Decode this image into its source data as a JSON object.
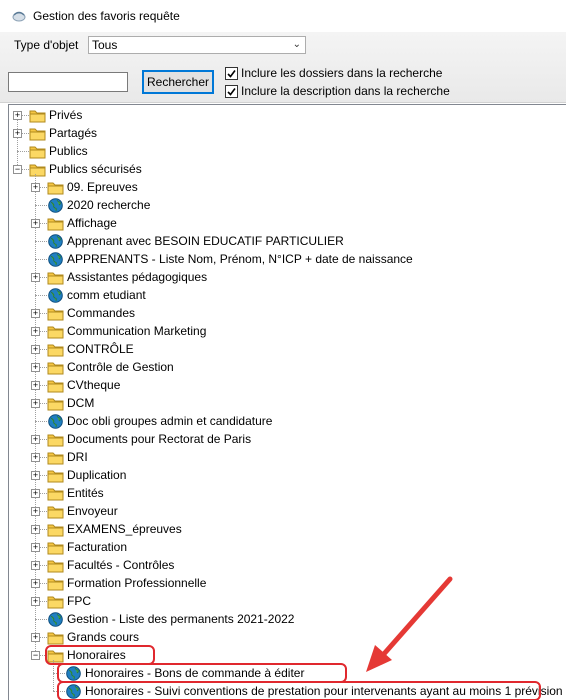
{
  "window": {
    "title": "Gestion des favoris requête",
    "icon": "app-icon"
  },
  "filters": {
    "type_label": "Type d'objet",
    "type_value": "Tous",
    "search_value": "",
    "search_button": "Rechercher",
    "include_folders_label": "Inclure les dossiers dans la recherche",
    "include_folders_checked": true,
    "include_description_label": "Inclure la description dans la recherche",
    "include_description_checked": true
  },
  "tree": {
    "top": [
      {
        "label": "Privés",
        "icon": "folder-icon",
        "expander": "+"
      },
      {
        "label": "Partagés",
        "icon": "folder-icon",
        "expander": "+"
      },
      {
        "label": "Publics",
        "icon": "folder-icon",
        "expander": ""
      },
      {
        "label": "Publics sécurisés",
        "icon": "folder-icon",
        "expander": "-"
      }
    ],
    "children": [
      {
        "label": "09. Epreuves",
        "icon": "folder-icon",
        "expander": "+"
      },
      {
        "label": "2020 recherche",
        "icon": "globe-icon",
        "expander": ""
      },
      {
        "label": "Affichage",
        "icon": "folder-icon",
        "expander": "+"
      },
      {
        "label": "Apprenant avec BESOIN EDUCATIF PARTICULIER",
        "icon": "globe-icon",
        "expander": ""
      },
      {
        "label": "APPRENANTS - Liste Nom, Prénom, N°ICP + date de naissance",
        "icon": "globe-icon",
        "expander": ""
      },
      {
        "label": "Assistantes pédagogiques",
        "icon": "folder-icon",
        "expander": "+"
      },
      {
        "label": "comm etudiant",
        "icon": "globe-icon",
        "expander": ""
      },
      {
        "label": "Commandes",
        "icon": "folder-icon",
        "expander": "+"
      },
      {
        "label": "Communication Marketing",
        "icon": "folder-icon",
        "expander": "+"
      },
      {
        "label": "CONTRÔLE",
        "icon": "folder-icon",
        "expander": "+"
      },
      {
        "label": "Contrôle de Gestion",
        "icon": "folder-icon",
        "expander": "+"
      },
      {
        "label": "CVtheque",
        "icon": "folder-icon",
        "expander": "+"
      },
      {
        "label": "DCM",
        "icon": "folder-icon",
        "expander": "+"
      },
      {
        "label": "Doc obli groupes admin et candidature",
        "icon": "globe-icon",
        "expander": ""
      },
      {
        "label": "Documents pour Rectorat de Paris",
        "icon": "folder-icon",
        "expander": "+"
      },
      {
        "label": "DRI",
        "icon": "folder-icon",
        "expander": "+"
      },
      {
        "label": "Duplication",
        "icon": "folder-icon",
        "expander": "+"
      },
      {
        "label": "Entités",
        "icon": "folder-icon",
        "expander": "+"
      },
      {
        "label": "Envoyeur",
        "icon": "folder-icon",
        "expander": "+"
      },
      {
        "label": "EXAMENS_épreuves",
        "icon": "folder-icon",
        "expander": "+"
      },
      {
        "label": "Facturation",
        "icon": "folder-icon",
        "expander": "+"
      },
      {
        "label": "Facultés - Contrôles",
        "icon": "folder-icon",
        "expander": "+"
      },
      {
        "label": "Formation Professionnelle",
        "icon": "folder-icon",
        "expander": "+"
      },
      {
        "label": "FPC",
        "icon": "folder-icon",
        "expander": "+"
      },
      {
        "label": "Gestion - Liste des permanents 2021-2022",
        "icon": "globe-icon",
        "expander": ""
      },
      {
        "label": "Grands cours",
        "icon": "folder-icon",
        "expander": "+"
      },
      {
        "label": "Honoraires",
        "icon": "folder-icon",
        "expander": "-"
      }
    ],
    "honoraires_children": [
      {
        "label": "Honoraires - Bons de commande à éditer",
        "icon": "globe-icon"
      },
      {
        "label": "Honoraires - Suivi conventions de prestation pour intervenants ayant au moins 1 prévision",
        "icon": "globe-icon"
      }
    ]
  },
  "colors": {
    "highlight": "#e0282e",
    "folder": "#f5c542",
    "globe": "#1f7fc1"
  }
}
